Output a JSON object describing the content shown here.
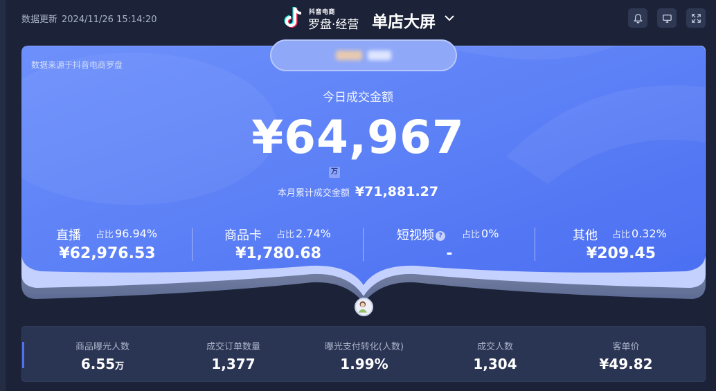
{
  "header": {
    "update_label": "数据更新",
    "update_time": "2024/11/26 15:14:20",
    "logo_small": "抖音电商",
    "logo_big": "罗盘·经营",
    "screen_title": "单店大屏",
    "icons": [
      "bell-icon",
      "monitor-icon",
      "fullscreen-icon"
    ]
  },
  "panel": {
    "source_note": "数据来源于抖音电商罗盘",
    "today_label": "今日成交金额",
    "today_value": "¥64,967",
    "unit_badge": "万",
    "month_label": "本月累计成交金额",
    "month_value": "¥71,881.27",
    "channels": [
      {
        "name": "直播",
        "share_label": "占比",
        "share": "96.94%",
        "value": "¥62,976.53"
      },
      {
        "name": "商品卡",
        "share_label": "占比",
        "share": "2.74%",
        "value": "¥1,780.68"
      },
      {
        "name": "短视频",
        "share_label": "占比",
        "share": "0%",
        "value": "-",
        "help": "?"
      },
      {
        "name": "其他",
        "share_label": "占比",
        "share": "0.32%",
        "value": "¥209.45"
      }
    ]
  },
  "metrics": [
    {
      "label": "商品曝光人数",
      "value": "6.55",
      "unit": "万"
    },
    {
      "label": "成交订单数量",
      "value": "1,377"
    },
    {
      "label": "曝光支付转化(人数)",
      "value": "1.99%"
    },
    {
      "label": "成交人数",
      "value": "1,304"
    },
    {
      "label": "客单价",
      "value": "¥49.82"
    }
  ],
  "colors": {
    "page_bg": "#1c2338",
    "panel_blue": "#5b7ff7",
    "panel_light": "#a8bcff",
    "metrics_bg": "#2a3453",
    "accent": "#4e72f0"
  }
}
